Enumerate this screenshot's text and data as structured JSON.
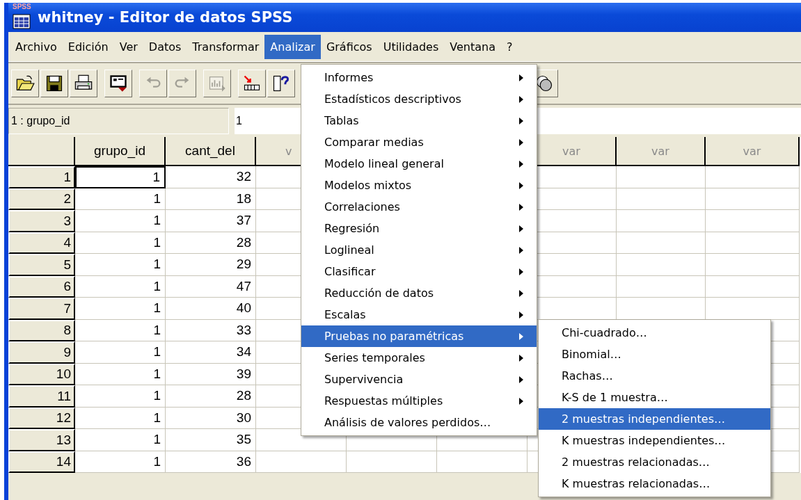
{
  "window": {
    "title": "whitney - Editor de datos SPSS",
    "icon_label": "SPSS"
  },
  "menu_bar": [
    {
      "label": "Archivo",
      "selected": false
    },
    {
      "label": "Edición",
      "selected": false
    },
    {
      "label": "Ver",
      "selected": false
    },
    {
      "label": "Datos",
      "selected": false
    },
    {
      "label": "Transformar",
      "selected": false
    },
    {
      "label": "Analizar",
      "selected": true
    },
    {
      "label": "Gráficos",
      "selected": false
    },
    {
      "label": "Utilidades",
      "selected": false
    },
    {
      "label": "Ventana",
      "selected": false
    },
    {
      "label": "?",
      "selected": false
    }
  ],
  "toolbar": [
    [
      {
        "kind": "open",
        "disabled": false
      },
      {
        "kind": "save",
        "disabled": false
      },
      {
        "kind": "print",
        "disabled": false
      }
    ],
    [
      {
        "kind": "recall",
        "disabled": false
      }
    ],
    [
      {
        "kind": "undo",
        "disabled": true
      },
      {
        "kind": "redo",
        "disabled": true
      }
    ],
    [
      {
        "kind": "chart",
        "disabled": true
      }
    ],
    [
      {
        "kind": "goto",
        "disabled": false
      },
      {
        "kind": "variables",
        "disabled": false
      }
    ],
    [
      {
        "kind": "sets",
        "disabled": false
      }
    ]
  ],
  "cell_editor": {
    "label": "1 : grupo_id",
    "value": "1"
  },
  "table": {
    "columns": [
      {
        "header": "grupo_id"
      },
      {
        "header": "cant_del"
      },
      {
        "header": "v"
      },
      {},
      {},
      {
        "header": "var"
      },
      {
        "header": "var"
      },
      {
        "header": "var"
      }
    ],
    "rows": [
      {
        "label": "1",
        "cells": [
          {
            "value": "1",
            "selected": true
          },
          {
            "value": "32",
            "selected": false
          }
        ]
      },
      {
        "label": "2",
        "cells": [
          {
            "value": "1",
            "selected": false
          },
          {
            "value": "18",
            "selected": false
          }
        ]
      },
      {
        "label": "3",
        "cells": [
          {
            "value": "1",
            "selected": false
          },
          {
            "value": "37",
            "selected": false
          }
        ]
      },
      {
        "label": "4",
        "cells": [
          {
            "value": "1",
            "selected": false
          },
          {
            "value": "28",
            "selected": false
          }
        ]
      },
      {
        "label": "5",
        "cells": [
          {
            "value": "1",
            "selected": false
          },
          {
            "value": "29",
            "selected": false
          }
        ]
      },
      {
        "label": "6",
        "cells": [
          {
            "value": "1",
            "selected": false
          },
          {
            "value": "47",
            "selected": false
          }
        ]
      },
      {
        "label": "7",
        "cells": [
          {
            "value": "1",
            "selected": false
          },
          {
            "value": "40",
            "selected": false
          }
        ]
      },
      {
        "label": "8",
        "cells": [
          {
            "value": "1",
            "selected": false
          },
          {
            "value": "33",
            "selected": false
          }
        ]
      },
      {
        "label": "9",
        "cells": [
          {
            "value": "1",
            "selected": false
          },
          {
            "value": "34",
            "selected": false
          }
        ]
      },
      {
        "label": "10",
        "cells": [
          {
            "value": "1",
            "selected": false
          },
          {
            "value": "39",
            "selected": false
          }
        ]
      },
      {
        "label": "11",
        "cells": [
          {
            "value": "1",
            "selected": false
          },
          {
            "value": "28",
            "selected": false
          }
        ]
      },
      {
        "label": "12",
        "cells": [
          {
            "value": "1",
            "selected": false
          },
          {
            "value": "30",
            "selected": false
          }
        ]
      },
      {
        "label": "13",
        "cells": [
          {
            "value": "1",
            "selected": false
          },
          {
            "value": "35",
            "selected": false
          }
        ]
      },
      {
        "label": "14",
        "cells": [
          {
            "value": "1",
            "selected": false
          },
          {
            "value": "36",
            "selected": false
          }
        ]
      }
    ]
  },
  "analyze_menu": [
    {
      "label": "Informes",
      "submenu": true,
      "selected": false
    },
    {
      "label": "Estadísticos descriptivos",
      "submenu": true,
      "selected": false
    },
    {
      "label": "Tablas",
      "submenu": true,
      "selected": false
    },
    {
      "label": "Comparar medias",
      "submenu": true,
      "selected": false
    },
    {
      "label": "Modelo lineal general",
      "submenu": true,
      "selected": false
    },
    {
      "label": "Modelos mixtos",
      "submenu": true,
      "selected": false
    },
    {
      "label": "Correlaciones",
      "submenu": true,
      "selected": false
    },
    {
      "label": "Regresión",
      "submenu": true,
      "selected": false
    },
    {
      "label": "Loglineal",
      "submenu": true,
      "selected": false
    },
    {
      "label": "Clasificar",
      "submenu": true,
      "selected": false
    },
    {
      "label": "Reducción de datos",
      "submenu": true,
      "selected": false
    },
    {
      "label": "Escalas",
      "submenu": true,
      "selected": false
    },
    {
      "label": "Pruebas no paramétricas",
      "submenu": true,
      "selected": true
    },
    {
      "label": "Series temporales",
      "submenu": true,
      "selected": false
    },
    {
      "label": "Supervivencia",
      "submenu": true,
      "selected": false
    },
    {
      "label": "Respuestas múltiples",
      "submenu": true,
      "selected": false
    },
    {
      "label": "Análisis de valores perdidos…",
      "submenu": false,
      "selected": false
    }
  ],
  "nonparametric_submenu": [
    {
      "label": "Chi-cuadrado…",
      "selected": false
    },
    {
      "label": "Binomial…",
      "selected": false
    },
    {
      "label": "Rachas…",
      "selected": false
    },
    {
      "label": "K-S de 1 muestra…",
      "selected": false
    },
    {
      "label": "2 muestras independientes…",
      "selected": true
    },
    {
      "label": "K muestras independientes…",
      "selected": false
    },
    {
      "label": "2 muestras relacionadas…",
      "selected": false
    },
    {
      "label": "K muestras relacionadas…",
      "selected": false
    }
  ]
}
